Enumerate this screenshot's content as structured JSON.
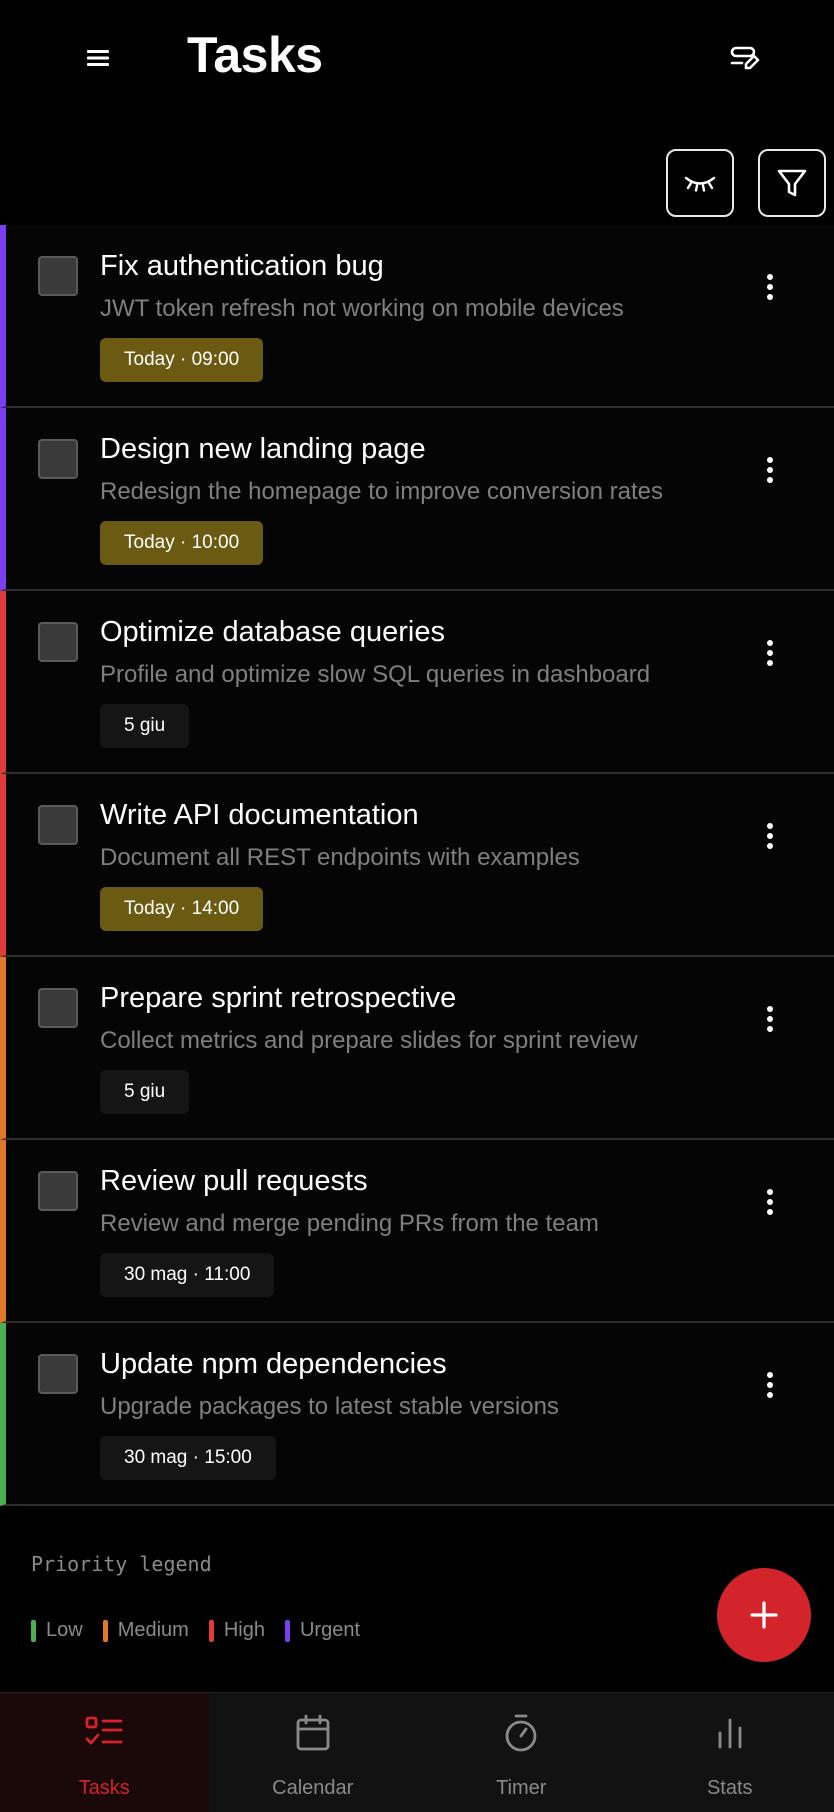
{
  "header": {
    "title": "Tasks"
  },
  "icons": {
    "menu": "menu-icon",
    "header_action": "list-edit-icon",
    "hide": "eye-closed-icon",
    "filter": "filter-icon",
    "more": "kebab-icon",
    "add": "plus-icon"
  },
  "tasks": [
    {
      "title": "Fix authentication bug",
      "description": "JWT token refresh not working on mobile devices",
      "date": "Today · 09:00",
      "priority_color": "#7b3ff2"
    },
    {
      "title": "Design new landing page",
      "description": "Redesign the homepage to improve conversion rates",
      "date": "Today · 10:00",
      "priority_color": "#7b3ff2"
    },
    {
      "title": "Optimize database queries",
      "description": "Profile and optimize slow SQL queries in dashboard",
      "date": "5 giu",
      "priority_color": "#e03c3c"
    },
    {
      "title": "Write API documentation",
      "description": "Document all REST endpoints with examples",
      "date": "Today · 14:00",
      "priority_color": "#e03c3c"
    },
    {
      "title": "Prepare sprint retrospective",
      "description": "Collect metrics and prepare slides for sprint review",
      "date": "5 giu",
      "priority_color": "#e0782a"
    },
    {
      "title": "Review pull requests",
      "description": "Review and merge pending PRs from the team",
      "date": "30 mag · 11:00",
      "priority_color": "#e0782a"
    },
    {
      "title": "Update npm dependencies",
      "description": "Upgrade packages to latest stable versions",
      "date": "30 mag · 15:00",
      "priority_color": "#4caf50"
    }
  ],
  "legend": {
    "title": "Priority legend",
    "items": [
      {
        "label": "Low",
        "color": "#4caf50"
      },
      {
        "label": "Medium",
        "color": "#e0782a"
      },
      {
        "label": "High",
        "color": "#e03c3c"
      },
      {
        "label": "Urgent",
        "color": "#7b3ff2"
      }
    ]
  },
  "nav": [
    {
      "label": "Tasks",
      "active": true,
      "icon": "tasks-icon"
    },
    {
      "label": "Calendar",
      "active": false,
      "icon": "calendar-icon"
    },
    {
      "label": "Timer",
      "active": false,
      "icon": "timer-icon"
    },
    {
      "label": "Stats",
      "active": false,
      "icon": "stats-icon"
    }
  ],
  "colors": {
    "accent": "#d3232b",
    "today_badge": "#6b5a12",
    "date_badge": "#151515",
    "muted_text": "#7f7f7f"
  }
}
